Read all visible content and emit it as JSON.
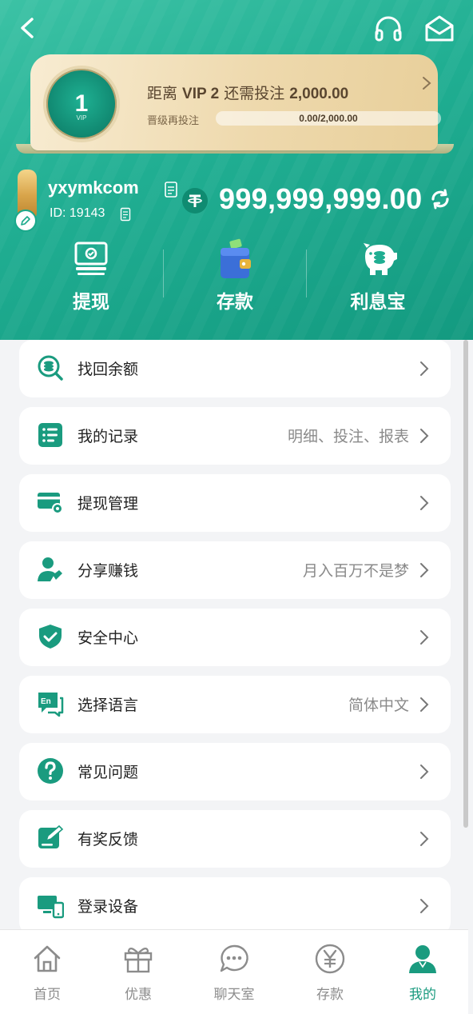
{
  "header": {
    "vip": {
      "level_badge": "1",
      "badge_sub": "VIP",
      "title_prefix": "距离 ",
      "target_level": "VIP 2",
      "title_middle": " 还需投注 ",
      "needed_amount": "2,000.00",
      "progress_label": "晋级再投注",
      "progress_text": "0.00/2,000.00",
      "progress_fraction": 0.0
    },
    "user": {
      "username": "yxymkcom",
      "id_text": "ID: 19143"
    },
    "balance": "999,999,999.00",
    "actions": [
      {
        "label": "提现",
        "icon": "withdraw-cash-icon"
      },
      {
        "label": "存款",
        "icon": "wallet-deposit-icon"
      },
      {
        "label": "利息宝",
        "icon": "piggy-bank-icon"
      }
    ]
  },
  "menu": [
    {
      "label": "找回余额",
      "hint": "",
      "icon": "recover-balance-icon"
    },
    {
      "label": "我的记录",
      "hint": "明细、投注、报表",
      "icon": "records-list-icon"
    },
    {
      "label": "提现管理",
      "hint": "",
      "icon": "card-settings-icon"
    },
    {
      "label": "分享赚钱",
      "hint": "月入百万不是梦",
      "icon": "share-user-icon"
    },
    {
      "label": "安全中心",
      "hint": "",
      "icon": "shield-check-icon"
    },
    {
      "label": "选择语言",
      "hint": "简体中文",
      "icon": "language-icon"
    },
    {
      "label": "常见问题",
      "hint": "",
      "icon": "question-icon"
    },
    {
      "label": "有奖反馈",
      "hint": "",
      "icon": "feedback-edit-icon"
    },
    {
      "label": "登录设备",
      "hint": "",
      "icon": "devices-icon"
    }
  ],
  "tabs": [
    {
      "label": "首页",
      "icon": "home-icon",
      "active": false
    },
    {
      "label": "优惠",
      "icon": "gift-icon",
      "active": false
    },
    {
      "label": "聊天室",
      "icon": "chat-icon",
      "active": false
    },
    {
      "label": "存款",
      "icon": "yen-coin-icon",
      "active": false
    },
    {
      "label": "我的",
      "icon": "profile-icon",
      "active": true
    }
  ],
  "colors": {
    "primary": "#1aa98b",
    "header_start": "#3cc2a5",
    "header_end": "#139a80",
    "vip_card": "#eed9ad",
    "tab_active": "#1a9b7f",
    "tab_inactive": "#8c8c8c"
  }
}
